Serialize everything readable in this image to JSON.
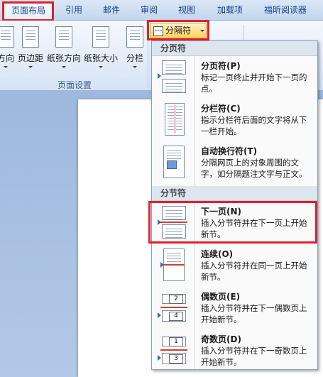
{
  "tabs": [
    {
      "label": "页面布局",
      "active": true
    },
    {
      "label": "引用"
    },
    {
      "label": "邮件"
    },
    {
      "label": "审阅"
    },
    {
      "label": "视图"
    },
    {
      "label": "加载项"
    },
    {
      "label": "福昕阅读器"
    }
  ],
  "ribbon": {
    "buttons": [
      {
        "label": "方向"
      },
      {
        "label": "页边距"
      },
      {
        "label": "纸张方向"
      },
      {
        "label": "纸张大小"
      },
      {
        "label": "分栏"
      }
    ],
    "group_label": "页面设置",
    "breaks_button": "分隔符"
  },
  "menu": {
    "page_breaks_header": "分页符",
    "section_breaks_header": "分节符",
    "items": [
      {
        "title": "分页符(P)",
        "desc": "标记一页终止并开始下一页的点。"
      },
      {
        "title": "分栏符(C)",
        "desc": "指示分栏符后面的文字将从下一栏开始。"
      },
      {
        "title": "自动换行符(T)",
        "desc": "分隔网页上的对象周围的文字，如分隔题注文字与正文。"
      },
      {
        "title": "下一页(N)",
        "desc": "插入分节符并在下一页上开始新节。"
      },
      {
        "title": "连续(O)",
        "desc": "插入分节符并在同一页上开始新节。"
      },
      {
        "title": "偶数页(E)",
        "desc": "插入分节符并在下一偶数页上开始新节。",
        "badges": [
          "2",
          "4"
        ]
      },
      {
        "title": "奇数页(D)",
        "desc": "插入分节符并在下一奇数页上开始新节。",
        "badges": [
          "1",
          "3"
        ]
      }
    ]
  },
  "colors": {
    "highlight_box": "#e0202e",
    "ribbon_accent": "#15428b"
  }
}
